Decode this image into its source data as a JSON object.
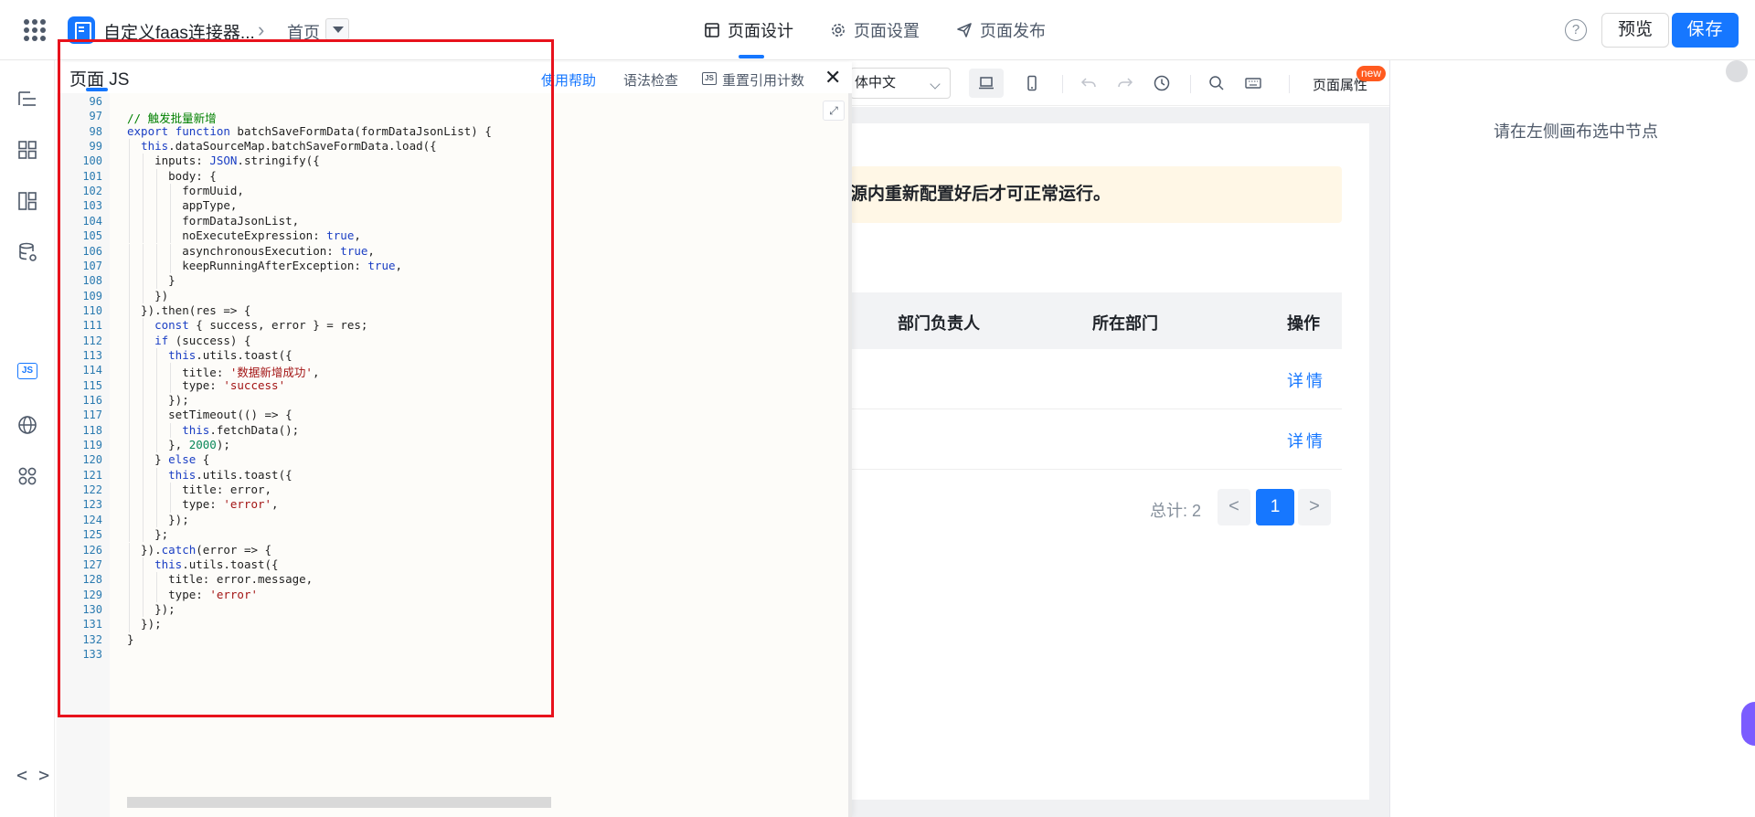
{
  "header": {
    "app_name": "自定义faas连接器...",
    "breadcrumb_page": "首页",
    "tabs": [
      {
        "label": "页面设计",
        "active": true
      },
      {
        "label": "页面设置",
        "active": false
      },
      {
        "label": "页面发布",
        "active": false
      }
    ],
    "help_symbol": "?",
    "preview_label": "预览",
    "save_label": "保存",
    "accent_color": "#1677ff"
  },
  "left_rail": {
    "icons": [
      "outline-icon",
      "components-icon",
      "layout-icon",
      "datasource-icon",
      "js-icon",
      "globe-icon",
      "plugins-icon",
      "code-icon"
    ],
    "js_label": "JS",
    "code_glyph": "< >"
  },
  "canvas": {
    "language_value": "体中文",
    "page_attr_label": "页面属性",
    "new_badge": "new",
    "notice_text": "源内重新配置好后才可正常运行。",
    "table_headers": [
      "部门负责人",
      "所在部门",
      "操作"
    ],
    "rows": [
      {
        "action": "详情"
      },
      {
        "action": "详情"
      }
    ],
    "pager": {
      "total_label": "总计: 2",
      "current_page": "1",
      "prev": "<",
      "next": ">"
    }
  },
  "right_panel": {
    "hint": "请在左侧画布选中节点"
  },
  "js_panel": {
    "title": "页面 JS",
    "help_link": "使用帮助",
    "lint_label": "语法检查",
    "reset_icon_text": "JS",
    "reset_label": "重置引用计数",
    "close_symbol": "✕",
    "expand_symbol": "⤢",
    "line_numbers": [
      "96",
      "97",
      "98",
      "99",
      "100",
      "101",
      "102",
      "103",
      "104",
      "105",
      "106",
      "107",
      "108",
      "109",
      "110",
      "111",
      "112",
      "113",
      "114",
      "115",
      "116",
      "117",
      "118",
      "119",
      "120",
      "121",
      "122",
      "123",
      "124",
      "125",
      "126",
      "127",
      "128",
      "129",
      "130",
      "131",
      "132",
      "133"
    ],
    "code_lines": [
      "",
      "// 触发批量新增",
      "export function batchSaveFormData(formDataJsonList) {",
      "  this.dataSourceMap.batchSaveFormData.load({",
      "    inputs: JSON.stringify({",
      "      body: {",
      "        formUuid,",
      "        appType,",
      "        formDataJsonList,",
      "        noExecuteExpression: true,",
      "        asynchronousExecution: true,",
      "        keepRunningAfterException: true,",
      "      }",
      "    })",
      "  }).then(res => {",
      "    const { success, error } = res;",
      "    if (success) {",
      "      this.utils.toast({",
      "        title: '数据新增成功',",
      "        type: 'success'",
      "      });",
      "      setTimeout(() => {",
      "        this.fetchData();",
      "      }, 2000);",
      "    } else {",
      "      this.utils.toast({",
      "        title: error,",
      "        type: 'error',",
      "      });",
      "    };",
      "  }).catch(error => {",
      "    this.utils.toast({",
      "      title: error.message,",
      "      type: 'error'",
      "    });",
      "  });",
      "}",
      ""
    ]
  },
  "colors": {
    "highlight_border": "#e8121c",
    "keyword": "#1a3ec4",
    "string": "#a31515",
    "comment": "#008000",
    "number": "#09885a"
  }
}
